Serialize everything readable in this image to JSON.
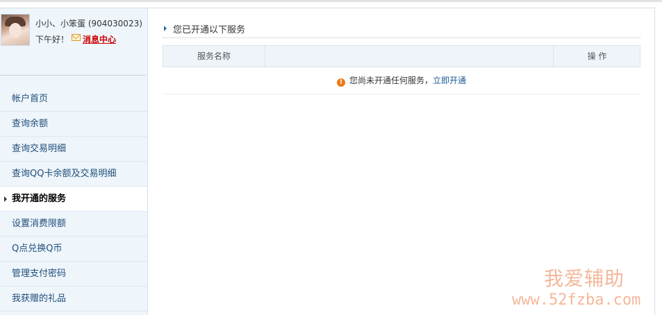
{
  "user": {
    "name": "小小、小笨蛋 (904030023)",
    "greeting": "下午好！",
    "message_center": "消息中心"
  },
  "nav": [
    {
      "label": "帐户首页",
      "active": false
    },
    {
      "label": "查询余额",
      "active": false
    },
    {
      "label": "查询交易明细",
      "active": false
    },
    {
      "label": "查询QQ卡余额及交易明细",
      "active": false
    },
    {
      "label": "我开通的服务",
      "active": true
    },
    {
      "label": "设置消费限额",
      "active": false
    },
    {
      "label": "Q点兑换Q币",
      "active": false
    },
    {
      "label": "管理支付密码",
      "active": false
    },
    {
      "label": "我获赠的礼品",
      "active": false
    }
  ],
  "main": {
    "section_title": "您已开通以下服务",
    "table": {
      "headers": [
        "服务名称",
        "",
        "操 作"
      ],
      "empty_message": "您尚未开通任何服务，",
      "open_link": "立即开通",
      "warn_glyph": "!"
    }
  },
  "watermark": {
    "line1": "我爱辅助",
    "line2": "www.52fzba.com"
  },
  "colors": {
    "sidebar_bg": "#eef5fb",
    "link": "#1f5a94",
    "nav_text": "#1f4e79",
    "alert": "#c00",
    "warn_icon": "#ea7a18",
    "watermark": "#f4b79a"
  }
}
